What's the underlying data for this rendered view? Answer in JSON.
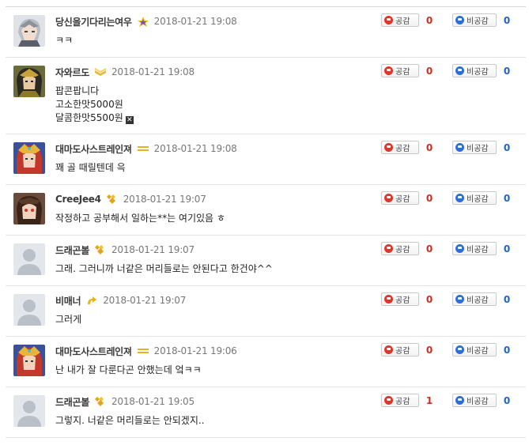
{
  "labels": {
    "up": "공감",
    "down": "비공감"
  },
  "comments": [
    {
      "nick": "당신을기다리는여우",
      "date": "2018-01-21  19:08",
      "lines": [
        "ㅋㅋ"
      ],
      "up": "0",
      "down": "0"
    },
    {
      "nick": "자와르도",
      "date": "2018-01-21  19:08",
      "lines": [
        "팝콘팝니다",
        "고소한맛5000원",
        "달콤한맛5500원"
      ],
      "up": "0",
      "down": "0"
    },
    {
      "nick": "대마도사스트레인져",
      "date": "2018-01-21  19:08",
      "lines": [
        "꽤 골 때릴텐데 윽"
      ],
      "up": "0",
      "down": "0"
    },
    {
      "nick": "CreeJee4",
      "date": "2018-01-21  19:07",
      "lines": [
        "작정하고 공부해서 일하는**는 여기있음 ㅎ"
      ],
      "up": "0",
      "down": "0"
    },
    {
      "nick": "드래곤볼",
      "date": "2018-01-21  19:07",
      "lines": [
        "그래. 그러니까 너같은 머리들로는 안된다고 한건야^^"
      ],
      "up": "0",
      "down": "0"
    },
    {
      "nick": "비매너",
      "date": "2018-01-21  19:07",
      "lines": [
        "그러게"
      ],
      "up": "0",
      "down": "0"
    },
    {
      "nick": "대마도사스트레인져",
      "date": "2018-01-21  19:06",
      "lines": [
        "난 내가 잘 다룬다곤 안했는데 엌ㅋㅋ"
      ],
      "up": "0",
      "down": "0"
    },
    {
      "nick": "드래곤볼",
      "date": "2018-01-21  19:05",
      "lines": [
        "그렇지. 너같은 머리들로는 안되겠지.."
      ],
      "up": "1",
      "down": "0"
    }
  ],
  "icons": {
    "up": "smile-icon",
    "down": "frown-icon",
    "close": "close-box-icon"
  },
  "colors": {
    "up": "#d42b20",
    "down": "#2262c6"
  }
}
